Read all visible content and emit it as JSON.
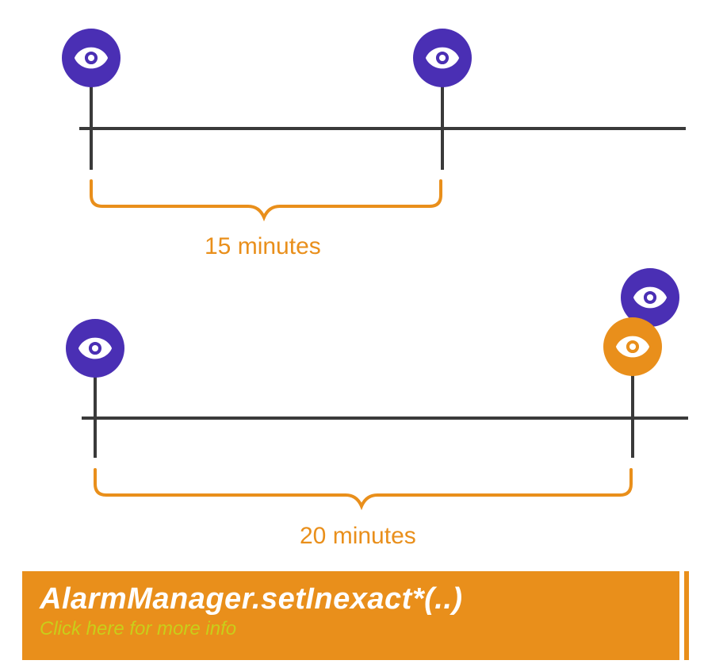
{
  "colors": {
    "purple": "#4a2fb4",
    "orange": "#e98f1b",
    "line": "#3a3a3a",
    "white": "#ffffff",
    "subtext": "#c9ce1a"
  },
  "timeline1": {
    "interval_label": "15 minutes",
    "markers": [
      {
        "name": "eye-marker-start",
        "color": "purple"
      },
      {
        "name": "eye-marker-end",
        "color": "purple"
      }
    ]
  },
  "timeline2": {
    "interval_label": "20 minutes",
    "markers": [
      {
        "name": "eye-marker-start",
        "color": "purple"
      },
      {
        "name": "eye-marker-back",
        "color": "purple"
      },
      {
        "name": "eye-marker-front",
        "color": "orange"
      }
    ]
  },
  "footer": {
    "title": "AlarmManager.setInexact*(..)",
    "subtitle": "Click here for more info"
  }
}
